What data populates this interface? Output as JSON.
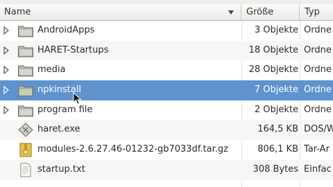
{
  "header": {
    "name_label": "Name",
    "size_label": "Größe",
    "type_label": "Typ"
  },
  "rows": [
    {
      "name": "AndroidApps",
      "size": "3 Objekte",
      "type": "Ordne",
      "icon": "folder-icon",
      "expander": true
    },
    {
      "name": "HARET-Startups",
      "size": "18 Objekte",
      "type": "Ordne",
      "icon": "folder-icon",
      "expander": true
    },
    {
      "name": "media",
      "size": "28 Objekte",
      "type": "Ordne",
      "icon": "folder-icon",
      "expander": true
    },
    {
      "name": "npkinstall",
      "size": "7 Objekte",
      "type": "Ordne",
      "icon": "folder-icon",
      "expander": true,
      "selected": true
    },
    {
      "name": "program file",
      "size": "2 Objekte",
      "type": "Ordne",
      "icon": "folder-icon",
      "expander": true
    },
    {
      "name": "haret.exe",
      "size": "164,5 KB",
      "type": "DOS/W",
      "icon": "executable-icon",
      "expander": false
    },
    {
      "name": "modules-2.6.27.46-01232-gb7033df.tar.gz",
      "size": "806,1 KB",
      "type": "Tar-Ar",
      "icon": "archive-icon",
      "expander": false
    },
    {
      "name": "startup.txt",
      "size": "308 Bytes",
      "type": "Einfac",
      "icon": "text-file-icon",
      "expander": false
    }
  ],
  "colors": {
    "selection": "#5f93ce",
    "folder": "#b9b9b1"
  }
}
